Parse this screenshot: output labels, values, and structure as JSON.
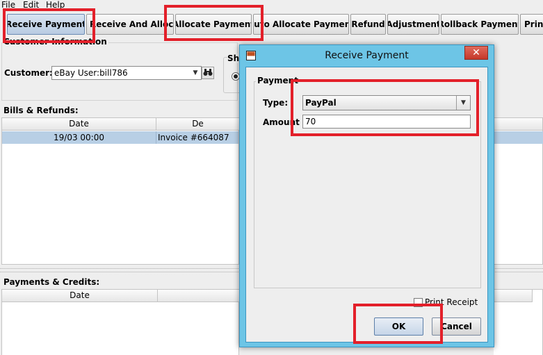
{
  "menu": [
    "File",
    "Edit",
    "Help"
  ],
  "toolbar": {
    "buttons": [
      "Receive Payment",
      "Receive And Allocate",
      "Allocate Payment",
      "Auto Allocate Payment",
      "Refund",
      "Adjustment",
      "Rollback Payment",
      "Print"
    ]
  },
  "customer_panel": {
    "title": "Customer Information",
    "customer_label": "Customer:",
    "customer_value": "eBay User:bill786",
    "show_label_partial": "Sho"
  },
  "bills_panel": {
    "title": "Bills & Refunds:",
    "columns": [
      "Date",
      "De"
    ],
    "rows": [
      {
        "date": "19/03 00:00",
        "description": "Invoice #664087"
      }
    ]
  },
  "payments_panel": {
    "title": "Payments & Credits:",
    "columns": [
      "Date"
    ]
  },
  "dialog": {
    "title": "Receive Payment",
    "group_title": "Payment",
    "type_label": "Type:",
    "type_value": "PayPal",
    "amount_label": "Amount",
    "amount_value": "70",
    "print_receipt_label": "Print Receipt",
    "print_receipt_checked": false,
    "ok_label": "OK",
    "cancel_label": "Cancel"
  },
  "colors": {
    "highlight": "#e3202a",
    "dialog_frame": "#6dc5e6",
    "selected_row": "#b8cfe5"
  }
}
